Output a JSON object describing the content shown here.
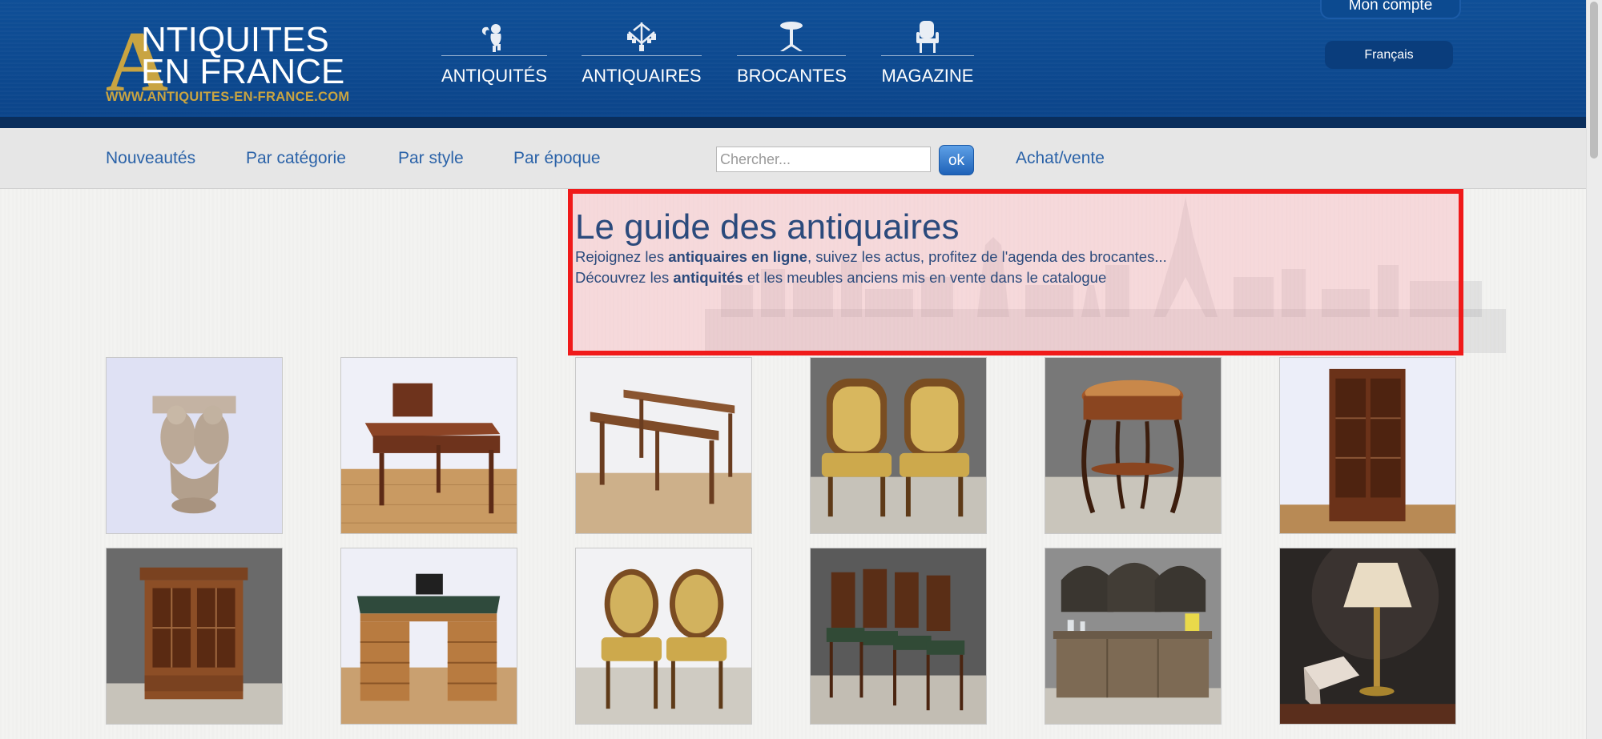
{
  "brand": {
    "big_letter": "A",
    "line1": "NTIQUITES",
    "line2": "EN FRANCE",
    "url": "WWW.ANTIQUITES-EN-FRANCE.COM"
  },
  "main_nav": [
    {
      "label": "ANTIQUITÉS",
      "icon": "cherub-icon"
    },
    {
      "label": "ANTIQUAIRES",
      "icon": "chandelier-icon"
    },
    {
      "label": "BROCANTES",
      "icon": "pedestal-table-icon"
    },
    {
      "label": "MAGAZINE",
      "icon": "armchair-icon"
    }
  ],
  "account": {
    "label": "Mon compte"
  },
  "language": {
    "label": "Français"
  },
  "subnav": [
    {
      "label": "Nouveautés"
    },
    {
      "label": "Par catégorie"
    },
    {
      "label": "Par style"
    },
    {
      "label": "Par époque"
    }
  ],
  "search": {
    "placeholder": "Chercher...",
    "button": "ok"
  },
  "achat": {
    "label": "Achat/vente"
  },
  "hero": {
    "title": "Le guide des antiquaires",
    "line1": {
      "pre": "Rejoignez les ",
      "bold": "antiquaires en ligne",
      "post": ", suivez les actus, profitez de l'agenda des brocantes..."
    },
    "line2": {
      "pre": "Découvrez les ",
      "bold": "antiquités",
      "post": " et les meubles anciens mis en vente dans le catalogue"
    }
  },
  "colors": {
    "header_blue": "#0b4489",
    "gold": "#c9a441",
    "link_blue": "#2a62a8",
    "highlight_red": "#f01a1a"
  }
}
